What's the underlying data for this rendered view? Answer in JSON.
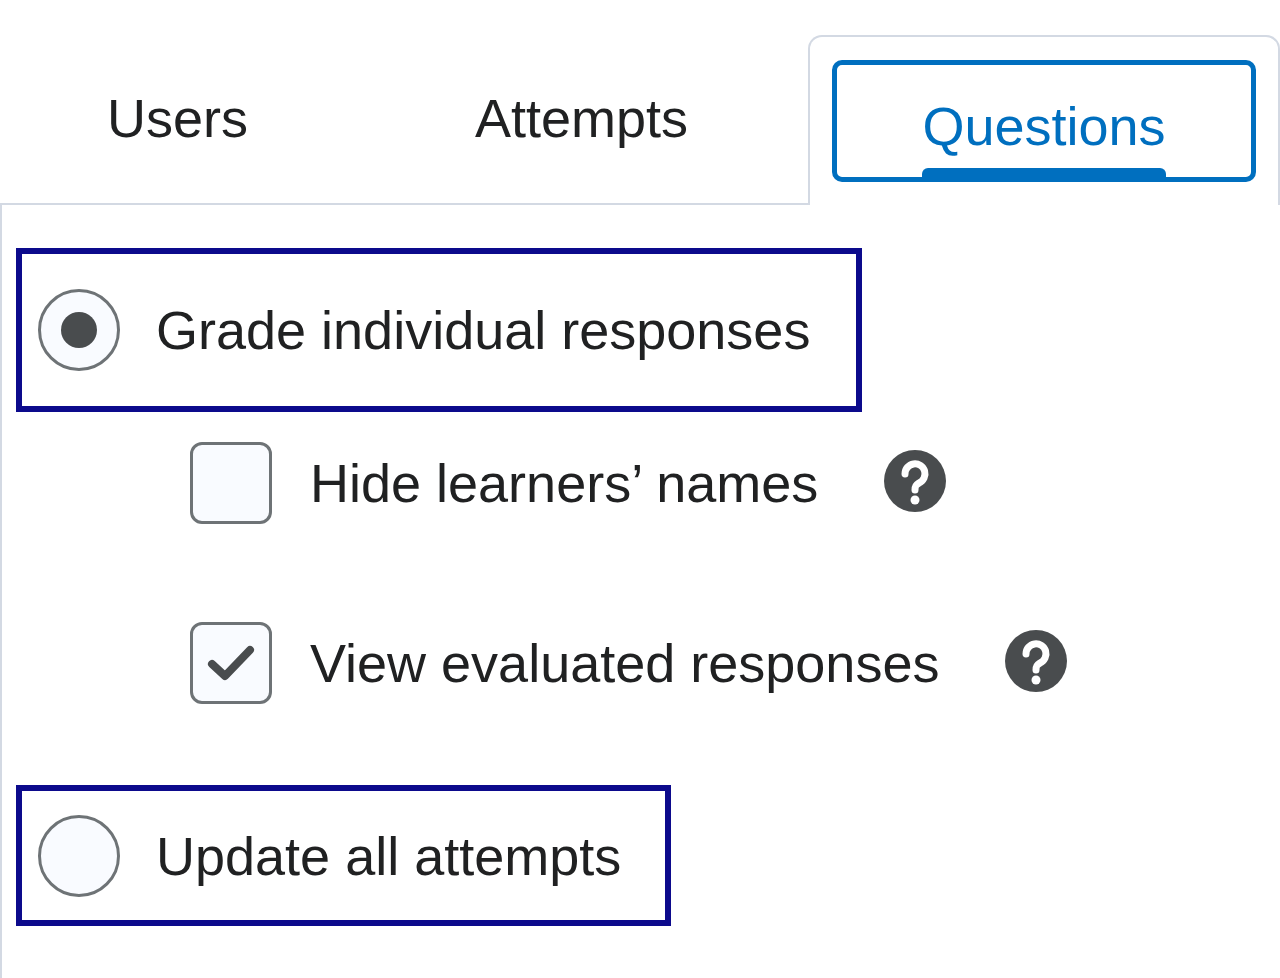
{
  "tabs": [
    {
      "label": "Users",
      "selected": false
    },
    {
      "label": "Attempts",
      "selected": false
    },
    {
      "label": "Questions",
      "selected": true
    }
  ],
  "options": [
    {
      "kind": "radio",
      "label": "Grade individual responses",
      "selected": true,
      "highlighted": true,
      "children": [
        {
          "kind": "checkbox",
          "label": "Hide learners’ names",
          "checked": false,
          "help": true
        },
        {
          "kind": "checkbox",
          "label": "View evaluated responses",
          "checked": true,
          "help": true
        }
      ]
    },
    {
      "kind": "radio",
      "label": "Update all attempts",
      "selected": false,
      "highlighted": true
    }
  ]
}
